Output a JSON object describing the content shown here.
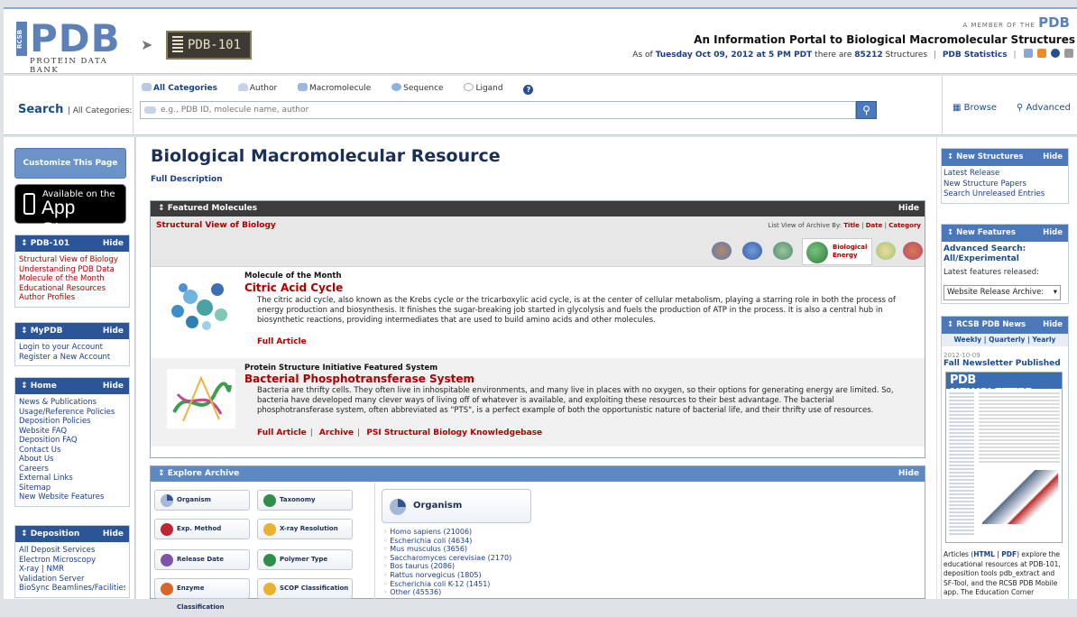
{
  "header": {
    "logo_side_text": "RCSB",
    "logo_text": "PDB",
    "logo_subtitle": "PROTEIN DATA BANK",
    "pdb101_label": "PDB-101",
    "member_text": "A MEMBER OF THE",
    "member_logo": "PDB",
    "portal_title": "An Information Portal to Biological Macromolecular Structures",
    "as_of_prefix": "As of",
    "as_of_date": "Tuesday Oct 09, 2012 at 5 PM PDT",
    "as_of_middle": "there are",
    "structure_count": "85212",
    "as_of_suffix": "Structures",
    "stats_link": "PDB Statistics"
  },
  "search": {
    "label": "Search",
    "label_sub": "All Categories:",
    "categories": [
      "All Categories",
      "Author",
      "Macromolecule",
      "Sequence",
      "Ligand"
    ],
    "help_icon": "?",
    "placeholder": "e.g., PDB ID, molecule name, author",
    "browse_label": "Browse",
    "advanced_label": "Advanced"
  },
  "left": {
    "customize_label": "Customize This Page",
    "appstore_line1": "Available on the",
    "appstore_line2": "App Store",
    "hide_label": "Hide",
    "pdb101": {
      "title": "PDB-101",
      "items": [
        "Structural View of Biology",
        "Understanding PDB Data",
        "Molecule of the Month",
        "Educational Resources",
        "Author Profiles"
      ]
    },
    "mypdb": {
      "title": "MyPDB",
      "items": [
        "Login to your Account",
        "Register a New Account"
      ]
    },
    "home": {
      "title": "Home",
      "items": [
        "News & Publications",
        "Usage/Reference Policies",
        "Deposition Policies",
        "Website FAQ",
        "Deposition FAQ",
        "Contact Us",
        "About Us",
        "Careers",
        "External Links",
        "Sitemap",
        "New Website Features"
      ]
    },
    "deposition": {
      "title": "Deposition",
      "items": [
        "All Deposit Services",
        "Electron Microscopy",
        "X-ray | NMR",
        "Validation Server",
        "BioSync Beamlines/Facilities"
      ]
    }
  },
  "main": {
    "title": "Biological Macromolecular Resource",
    "full_description": "Full Description",
    "featured_title": "Featured Molecules",
    "hide_label": "Hide",
    "structural_view": "Structural View of Biology",
    "list_view_prefix": "List View of Archive By:",
    "list_view_options": [
      "Title",
      "Date",
      "Category"
    ],
    "bio_energy_label": "Biological Energy",
    "motm": {
      "kicker": "Molecule of the Month",
      "title": "Citric Acid Cycle",
      "desc": "The citric acid cycle, also known as the Krebs cycle or the tricarboxylic acid cycle, is at the center of cellular metabolism, playing a starring role in both the process of energy production and biosynthesis. It finishes the sugar-breaking job started in glycolysis and fuels the production of ATP in the process. It is also a central hub in biosynthetic reactions, providing intermediates that are used to build amino acids and other molecules.",
      "link": "Full Article"
    },
    "psi": {
      "kicker": "Protein Structure Initiative Featured System",
      "title": "Bacterial Phosphotransferase System",
      "desc": "Bacteria are thrifty cells. They often live in inhospitable environments, and many live in places with no oxygen, so their options for generating energy are limited. So, bacteria have developed many clever ways of living off of whatever is available, and exploiting these resources to their best advantage. The bacterial phosphotransferase system, often abbreviated as \"PTS\", is a perfect example of both the opportunistic nature of bacterial life, and their thrifty use of resources.",
      "links": [
        "Full Article",
        "Archive",
        "PSI Structural Biology Knowledgebase"
      ]
    },
    "explore": {
      "title": "Explore Archive",
      "buttons": [
        "Organism",
        "Taxonomy",
        "Exp. Method",
        "X-ray Resolution",
        "Release Date",
        "Polymer Type",
        "Enzyme Classification",
        "SCOP Classification"
      ],
      "selected": "Organism",
      "organisms": [
        "Homo sapiens (21006)",
        "Escherichia coli (4634)",
        "Mus musculus (3656)",
        "Saccharomyces cerevisiae (2170)",
        "Bos taurus (2086)",
        "Rattus norvegicus (1805)",
        "Escherichia coli K-12 (1451)",
        "Other (45536)"
      ]
    }
  },
  "right": {
    "hide_label": "Hide",
    "new_structures": {
      "title": "New Structures",
      "items": [
        "Latest Release",
        "New Structure Papers",
        "Search Unreleased Entries"
      ]
    },
    "new_features": {
      "title": "New Features",
      "adv_search": "Advanced Search: All/Experimental",
      "latest": "Latest features released:",
      "select_value": "Website Release Archive:"
    },
    "news": {
      "title": "RCSB PDB News",
      "periods": "Weekly | Quarterly | Yearly",
      "date": "2012-10-09",
      "headline": "Fall Newsletter Published",
      "newsletter_logo": "PDB",
      "newsletter_word": "NEWSLETTER",
      "text_prefix": "Articles (",
      "text_html": "HTML",
      "text_sep": " | ",
      "text_pdf": "PDF",
      "text_rest": ") explore the educational resources at PDB-101, deposition tools pdb_extract and SF-Tool, and the RCSB PDB Mobile app. The Education Corner"
    }
  }
}
